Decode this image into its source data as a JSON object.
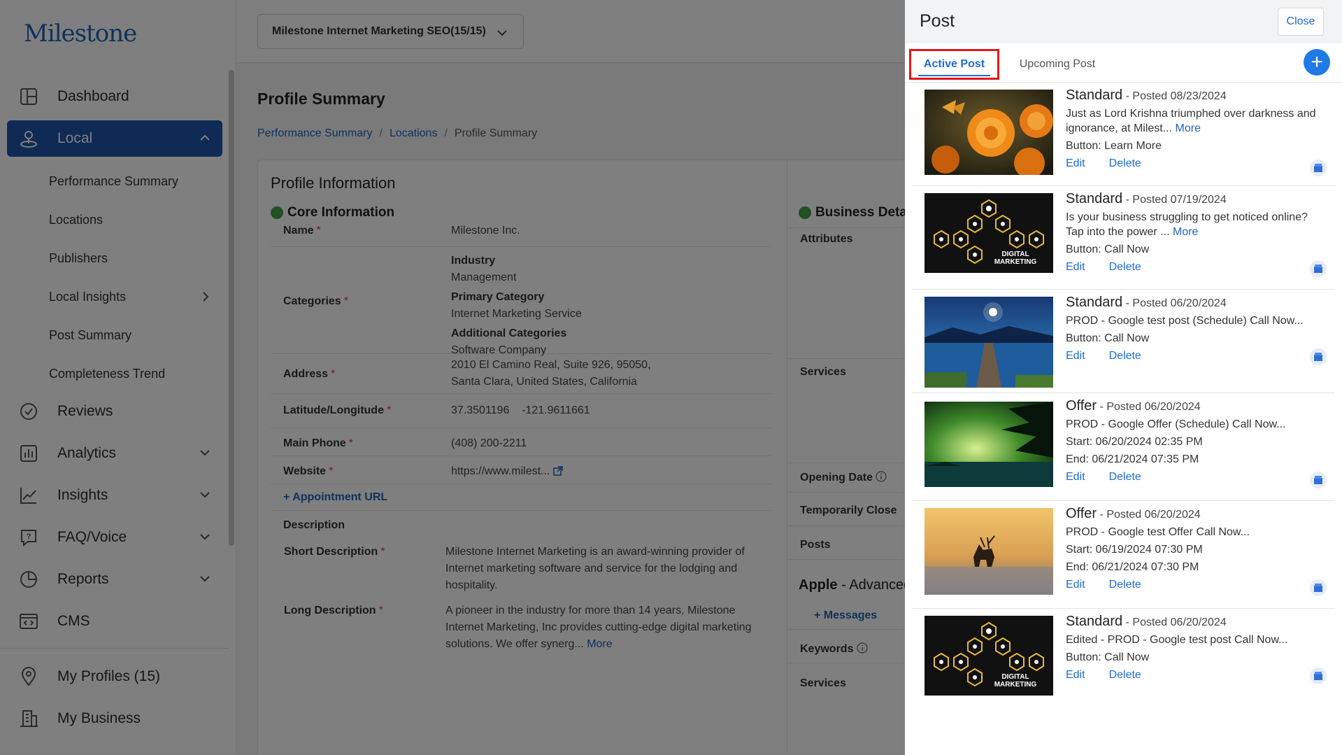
{
  "app": {
    "logo": "Milestone"
  },
  "sidebar": {
    "items": [
      {
        "label": "Dashboard",
        "icon": "dashboard-icon"
      },
      {
        "label": "Local",
        "icon": "local-pin-icon",
        "active": true
      },
      {
        "label": "Reviews",
        "icon": "reviews-icon"
      },
      {
        "label": "Analytics",
        "icon": "analytics-icon"
      },
      {
        "label": "Insights",
        "icon": "insights-icon"
      },
      {
        "label": "FAQ/Voice",
        "icon": "faq-icon"
      },
      {
        "label": "Reports",
        "icon": "reports-icon"
      },
      {
        "label": "CMS",
        "icon": "cms-icon"
      }
    ],
    "local_sub": [
      "Performance Summary",
      "Locations",
      "Publishers",
      "Local Insights",
      "Post Summary",
      "Completeness Trend"
    ],
    "bottom": [
      {
        "label": "My Profiles (15)",
        "icon": "location-icon"
      },
      {
        "label": "My Business",
        "icon": "building-icon"
      }
    ]
  },
  "topbar": {
    "location_select": "Milestone Internet Marketing SEO(15/15)"
  },
  "page": {
    "title": "Profile Summary",
    "breadcrumb": [
      "Performance Summary",
      "Locations",
      "Profile Summary"
    ]
  },
  "profile": {
    "card_title": "Profile Information",
    "core_title": "Core Information",
    "business_title": "Business Deta",
    "name": {
      "label": "Name",
      "value": "Milestone Inc."
    },
    "categories": {
      "label": "Categories",
      "industry_label": "Industry",
      "industry": "Management",
      "primary_label": "Primary Category",
      "primary": "Internet Marketing Service",
      "additional_label": "Additional Categories",
      "additional": "Software Company"
    },
    "address": {
      "label": "Address",
      "line1": "2010 El Camino Real, Suite 926, 95050,",
      "line2": "Santa Clara, United States, California"
    },
    "latlng": {
      "label": "Latitude/Longitude",
      "lat": "37.3501196",
      "lng": "-121.9611661"
    },
    "phone": {
      "label": "Main Phone",
      "value": "(408) 200-2211"
    },
    "website": {
      "label": "Website",
      "value": "https://www.milest..."
    },
    "appointment": "Appointment URL",
    "description_label": "Description",
    "short_desc": {
      "label": "Short Description",
      "line1": "Milestone Internet Marketing is an award-winning provider of",
      "line2": "Internet marketing software and service for the lodging and",
      "line3": "hospitality."
    },
    "long_desc": {
      "label": "Long Description",
      "line1": "A pioneer in the industry for more than 14 years, Milestone",
      "line2": "Internet Marketing, Inc provides cutting-edge digital marketing",
      "line3": "solutions. We offer synerg...",
      "more": "More"
    },
    "right": {
      "attributes": "Attributes",
      "services": "Services",
      "opening_date": "Opening Date",
      "temp_closed": "Temporarily Close",
      "posts": "Posts",
      "apple_brand": "Apple",
      "apple_rest": " - Advanced",
      "messages": "Messages",
      "keywords": "Keywords",
      "services2": "Services"
    }
  },
  "panel": {
    "title": "Post",
    "close": "Close",
    "tabs": [
      "Active Post",
      "Upcoming Post"
    ],
    "add": "+",
    "posts": [
      {
        "type": "Standard",
        "date": " - Posted 08/23/2024",
        "line1": "Just as Lord Krishna triumphed over darkness and",
        "line2": "ignorance, at Milest...",
        "more": "More",
        "button": "Button: Learn More",
        "edit": "Edit",
        "delete": "Delete",
        "image": "orange-flowers"
      },
      {
        "type": "Standard",
        "date": " - Posted 07/19/2024",
        "line1": "Is your business struggling to get noticed online?",
        "line2": "Tap into the power ...",
        "more": "More",
        "button": "Button: Call Now",
        "edit": "Edit",
        "delete": "Delete",
        "image": "digital-marketing",
        "image_text": [
          "DIGITAL",
          "MARKETING"
        ]
      },
      {
        "type": "Standard",
        "date": " - Posted 06/20/2024",
        "line1": "PROD - Google test post (Schedule) Call Now...",
        "button": "Button: Call Now",
        "edit": "Edit",
        "delete": "Delete",
        "image": "lake-pier"
      },
      {
        "type": "Offer",
        "date": " - Posted 06/20/2024",
        "line1": "PROD - Google Offer (Schedule) Call Now...",
        "start": "Start: 06/20/2024 02:35 PM",
        "end": "End: 06/21/2024 07:35 PM",
        "edit": "Edit",
        "delete": "Delete",
        "image": "palm-sunset"
      },
      {
        "type": "Offer",
        "date": " - Posted 06/20/2024",
        "line1": "PROD - Google test Offer Call Now...",
        "start": "Start: 06/19/2024 07:30 PM",
        "end": "End: 06/21/2024 07:30 PM",
        "edit": "Edit",
        "delete": "Delete",
        "image": "deer-fog"
      },
      {
        "type": "Standard",
        "date": " - Posted 06/20/2024",
        "line1": "Edited - PROD - Google test post Call Now...",
        "button": "Button: Call Now",
        "edit": "Edit",
        "delete": "Delete",
        "image": "digital-marketing",
        "image_text": [
          "DIGITAL",
          "MARKETING"
        ]
      }
    ]
  },
  "colors": {
    "brand": "#1f55a8",
    "link": "#1f6bd6",
    "active_tab_border": "#e0181b",
    "status_green": "#43a047"
  }
}
